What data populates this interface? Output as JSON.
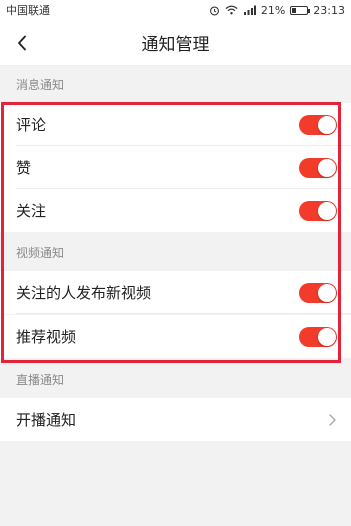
{
  "status_bar": {
    "carrier": "中国联通",
    "battery": "21%",
    "battery_level": 0.21,
    "time": "23:13"
  },
  "nav": {
    "title": "通知管理"
  },
  "sections": [
    {
      "header": "消息通知",
      "rows": [
        {
          "label": "评论",
          "toggle_on": true
        },
        {
          "label": "赞",
          "toggle_on": true
        },
        {
          "label": "关注",
          "toggle_on": true
        }
      ]
    },
    {
      "header": "视频通知",
      "rows": [
        {
          "label": "关注的人发布新视频",
          "toggle_on": true
        },
        {
          "label": "推荐视频",
          "toggle_on": true
        }
      ]
    },
    {
      "header": "直播通知",
      "rows": [
        {
          "label": "开播通知",
          "type": "link"
        }
      ]
    }
  ],
  "colors": {
    "toggle_on": "#f23b2a",
    "highlight": "#e2233a",
    "background": "#f2f2f2"
  }
}
